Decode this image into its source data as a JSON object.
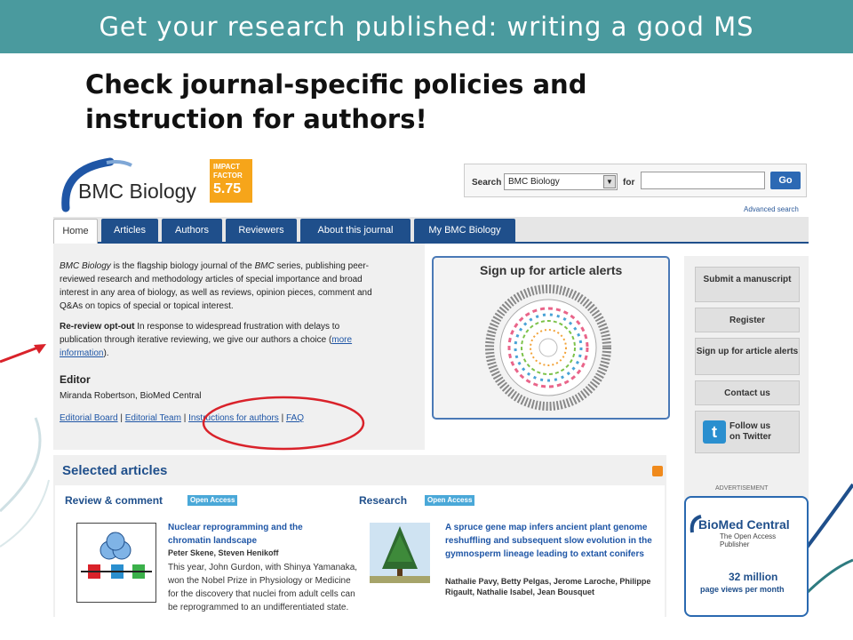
{
  "slide": {
    "title": "Get your research published: writing a good MS",
    "subtitle_line1": "Check journal-specific policies and",
    "subtitle_line2": "instruction for authors!"
  },
  "colors": {
    "title_bar": "#4a9a9e",
    "nav_tab": "#1f4f8b",
    "link": "#1f56a6",
    "impact_badge": "#f6a51a",
    "annotation_red": "#d9222a"
  },
  "site": {
    "logo_text": "BMC Biology",
    "impact": {
      "line1": "IMPACT",
      "line2": "FACTOR",
      "value": "5.75"
    },
    "search": {
      "label": "Search",
      "selected": "BMC Biology",
      "for_label": "for",
      "button": "Go",
      "advanced": "Advanced search"
    },
    "tabs": [
      "Home",
      "Articles",
      "Authors",
      "Reviewers",
      "About this journal",
      "My BMC Biology"
    ],
    "intro": {
      "journal_name": "BMC Biology",
      "line1_rest": " is the flagship biology journal of the ",
      "bmc": "BMC",
      "line1_end": " series, publishing peer-",
      "line2": "reviewed research and methodology articles of special importance and broad",
      "line3": "interest in any area of biology, as well as reviews, opinion pieces, comment and",
      "line4": "Q&As on topics of special or topical interest."
    },
    "rereview": {
      "bold": "Re-review opt-out",
      "line1_rest": " In response to widespread frustration with delays to",
      "line2": "publication through iterative reviewing, we give our authors a choice (",
      "link_a": "more",
      "link_b": "information",
      "end": ")."
    },
    "editor": {
      "heading": "Editor",
      "name": "Miranda Robertson, BioMed Central"
    },
    "links": [
      "Editorial Board",
      "Editorial Team",
      "Instructions for authors",
      "FAQ"
    ],
    "link_sep": " | ",
    "alerts_title": "Sign up for article alerts",
    "sidebar_buttons": [
      "Submit a manuscript",
      "Register",
      "Sign up for article alerts",
      "Contact us",
      "Follow us on Twitter"
    ],
    "selected": {
      "heading": "Selected articles",
      "col1": {
        "heading": "Review & comment",
        "badge": "Open Access",
        "title": "Nuclear reprogramming and the chromatin landscape",
        "authors": "Peter Skene, Steven Henikoff",
        "body": "This year, John Gurdon, with Shinya Yamanaka, won the Nobel Prize in Physiology or Medicine for the discovery that nuclei from adult cells can be reprogrammed to an undifferentiated state."
      },
      "col2": {
        "heading": "Research",
        "badge": "Open Access",
        "title": "A spruce gene map infers ancient plant genome reshuffling and subsequent slow evolution in the gymnosperm lineage leading to extant conifers",
        "authors": "Nathalie Pavy, Betty Pelgas, Jerome Laroche, Philippe Rigault, Nathalie Isabel, Jean Bousquet"
      }
    },
    "advert": {
      "label": "ADVERTISEMENT",
      "brand": "BioMed Central",
      "tagline": "The Open Access Publisher",
      "number": "32 million",
      "text": "page views per month"
    }
  }
}
